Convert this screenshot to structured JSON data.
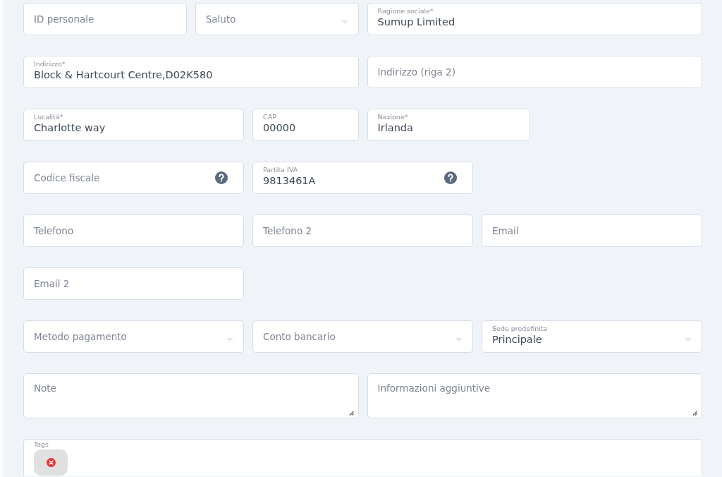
{
  "rows": [
    [
      {
        "kind": "input",
        "placeholder": "ID personale"
      },
      {
        "kind": "select",
        "placeholder": "Saluto"
      },
      {
        "kind": "input",
        "label": "Ragione sociale*",
        "value": "Sumup Limited"
      }
    ],
    [
      {
        "kind": "input",
        "label": "Indirizzo*",
        "value": "Block & Hartcourt Centre,D02K580"
      },
      {
        "kind": "input",
        "placeholder": "Indirizzo (riga 2)"
      }
    ],
    [
      {
        "kind": "input",
        "label": "Località*",
        "value": "Charlotte way"
      },
      {
        "kind": "input",
        "label": "CAP",
        "value": "00000"
      },
      {
        "kind": "input",
        "label": "Nazione*",
        "value": "Irlanda"
      }
    ],
    [
      {
        "kind": "input",
        "placeholder": "Codice fiscale",
        "help": true
      },
      {
        "kind": "input",
        "label": "Partita IVA",
        "value": "9813461A",
        "help": true
      }
    ],
    [
      {
        "kind": "input",
        "placeholder": "Telefono"
      },
      {
        "kind": "input",
        "placeholder": "Telefono 2"
      },
      {
        "kind": "input",
        "placeholder": "Email"
      }
    ],
    [
      {
        "kind": "input",
        "placeholder": "Email 2"
      }
    ],
    [
      {
        "kind": "select",
        "placeholder": "Metodo pagamento"
      },
      {
        "kind": "select",
        "placeholder": "Conto bancario"
      },
      {
        "kind": "select",
        "label": "Sede predefinita",
        "value": "Principale"
      }
    ],
    [
      {
        "kind": "textarea",
        "placeholder": "Note"
      },
      {
        "kind": "textarea",
        "placeholder": "Informazioni aggiuntive"
      }
    ],
    [
      {
        "kind": "tags",
        "label": "Tags",
        "tags": [
          {
            "removable": true
          }
        ]
      }
    ]
  ]
}
